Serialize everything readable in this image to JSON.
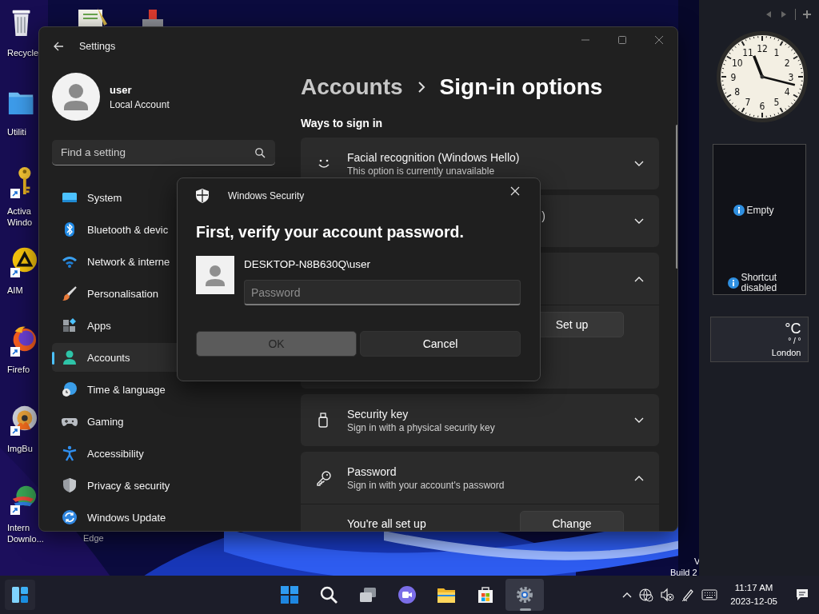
{
  "desktop": {
    "icons": [
      {
        "kind": "recycle",
        "lines": [
          "Recycle"
        ],
        "shortcut": false
      },
      {
        "kind": "folder",
        "lines": [
          "Utiliti"
        ],
        "shortcut": false
      },
      {
        "kind": "key",
        "lines": [
          "Activa",
          "Windo"
        ],
        "shortcut": true
      },
      {
        "kind": "media",
        "lines": [
          "AIM"
        ],
        "shortcut": true
      },
      {
        "kind": "browser",
        "lines": [
          "Firefo"
        ],
        "shortcut": true
      },
      {
        "kind": "disc",
        "lines": [
          "ImgBu"
        ],
        "shortcut": true
      },
      {
        "kind": "downloader",
        "lines": [
          "Intern",
          "Downlo..."
        ],
        "shortcut": true
      }
    ],
    "edge_label": "Edge",
    "system_text": [
      "V",
      "Build 2"
    ]
  },
  "settings": {
    "title": "Settings",
    "user": {
      "name": "user",
      "account": "Local Account"
    },
    "search": {
      "placeholder": "Find a setting"
    },
    "nav": [
      {
        "kind": "system",
        "label": "System",
        "selected": false
      },
      {
        "kind": "bluetooth",
        "label": "Bluetooth & devic",
        "selected": false
      },
      {
        "kind": "network",
        "label": "Network & interne",
        "selected": false
      },
      {
        "kind": "personalisation",
        "label": "Personalisation",
        "selected": false
      },
      {
        "kind": "apps",
        "label": "Apps",
        "selected": false
      },
      {
        "kind": "accounts",
        "label": "Accounts",
        "selected": true
      },
      {
        "kind": "time",
        "label": "Time & language",
        "selected": false
      },
      {
        "kind": "gaming",
        "label": "Gaming",
        "selected": false
      },
      {
        "kind": "accessibility",
        "label": "Accessibility",
        "selected": false
      },
      {
        "kind": "privacy",
        "label": "Privacy & security",
        "selected": false
      },
      {
        "kind": "update",
        "label": "Windows Update",
        "selected": false
      }
    ],
    "breadcrumb": [
      "Accounts",
      "Sign-in options"
    ],
    "section": "Ways to sign in",
    "cards": [
      {
        "kind": "face",
        "title": "Facial recognition (Windows Hello)",
        "subtitle": "This option is currently unavailable",
        "expanded": false
      },
      {
        "kind": "covered",
        "title": ")",
        "expanded": false
      },
      {
        "kind": "covered",
        "expanded": true,
        "detail_button": "Set up"
      },
      {
        "kind": "usbkey",
        "title": "Security key",
        "subtitle": "Sign in with a physical security key",
        "expanded": false
      },
      {
        "kind": "password",
        "title": "Password",
        "subtitle": "Sign in with your account's password",
        "expanded": true,
        "detail_text": "You're all set up",
        "detail_button": "Change"
      }
    ]
  },
  "dialog": {
    "title": "Windows Security",
    "heading": "First, verify your account password.",
    "account": "DESKTOP-N8B630Q\\user",
    "password": {
      "placeholder": "Password"
    },
    "buttons": [
      {
        "label": "OK",
        "kind": "primary",
        "disabled": true
      },
      {
        "label": "Cancel",
        "kind": "secondary",
        "disabled": false
      }
    ]
  },
  "gadgets": {
    "clock": {
      "numerals": [
        "12",
        "11",
        "1",
        "10",
        "2",
        "9",
        "3",
        "8",
        "4",
        "7",
        "5",
        "6"
      ]
    },
    "slideshow": {
      "messages": [
        "Empty",
        "Shortcut disabled"
      ]
    },
    "weather": {
      "unit": "°C",
      "range": "° / °",
      "city": "London"
    }
  },
  "taskbar": {
    "apps": [
      {
        "kind": "start",
        "active": false
      },
      {
        "kind": "search",
        "active": false
      },
      {
        "kind": "taskview",
        "active": false
      },
      {
        "kind": "chat",
        "active": false
      },
      {
        "kind": "explorer",
        "active": false
      },
      {
        "kind": "store",
        "active": false
      },
      {
        "kind": "settings",
        "active": true
      }
    ],
    "clock": {
      "time": "11:17 AM",
      "date": "2023-12-05"
    }
  }
}
